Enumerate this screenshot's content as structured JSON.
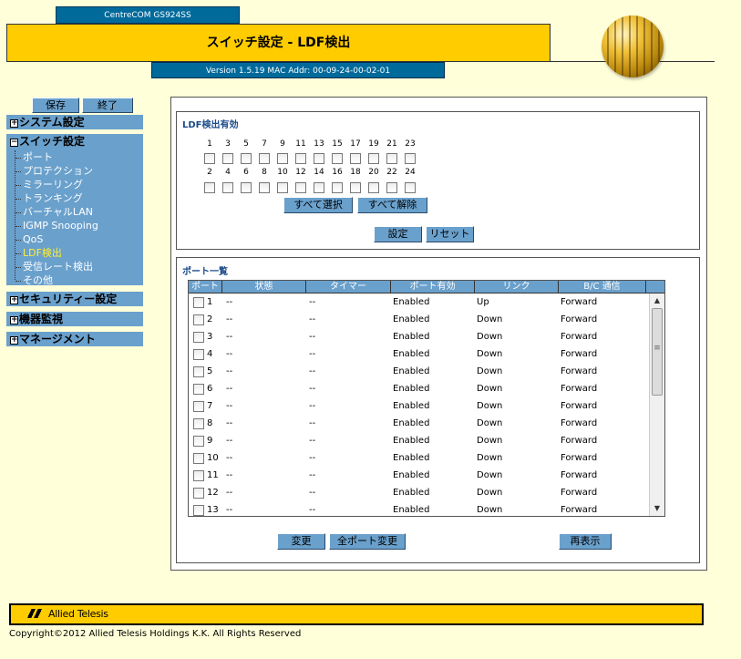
{
  "header": {
    "model": "CentreCOM GS924SS",
    "title": "スイッチ設定 - LDF検出",
    "version": "Version 1.5.19 MAC Addr: 00-09-24-00-02-01"
  },
  "nav": {
    "save_label": "保存",
    "exit_label": "終了",
    "system": "システム設定",
    "switch": "スイッチ設定",
    "switch_items": [
      "ポート",
      "プロテクション",
      "ミラーリング",
      "トランキング",
      "バーチャルLAN",
      "IGMP Snooping",
      "QoS",
      "LDF検出",
      "受信レート検出",
      "その他"
    ],
    "security": "セキュリティー設定",
    "monitor": "機器監視",
    "management": "マネージメント",
    "expand_glyph": "+",
    "collapse_glyph": "−"
  },
  "ldf": {
    "title": "LDF検出有効",
    "odd_ports": [
      "1",
      "3",
      "5",
      "7",
      "9",
      "11",
      "13",
      "15",
      "17",
      "19",
      "21",
      "23"
    ],
    "even_ports": [
      "2",
      "4",
      "6",
      "8",
      "10",
      "12",
      "14",
      "16",
      "18",
      "20",
      "22",
      "24"
    ],
    "select_all": "すべて選択",
    "clear_all": "すべて解除",
    "apply": "設定",
    "reset": "リセット"
  },
  "port_list": {
    "title": "ポート一覧",
    "columns": [
      "ポート",
      "状態",
      "タイマー",
      "ポート有効",
      "リンク",
      "B/C 通信"
    ],
    "rows": [
      [
        "1",
        "--",
        "--",
        "Enabled",
        "Up",
        "Forward"
      ],
      [
        "2",
        "--",
        "--",
        "Enabled",
        "Down",
        "Forward"
      ],
      [
        "3",
        "--",
        "--",
        "Enabled",
        "Down",
        "Forward"
      ],
      [
        "4",
        "--",
        "--",
        "Enabled",
        "Down",
        "Forward"
      ],
      [
        "5",
        "--",
        "--",
        "Enabled",
        "Down",
        "Forward"
      ],
      [
        "6",
        "--",
        "--",
        "Enabled",
        "Down",
        "Forward"
      ],
      [
        "7",
        "--",
        "--",
        "Enabled",
        "Down",
        "Forward"
      ],
      [
        "8",
        "--",
        "--",
        "Enabled",
        "Down",
        "Forward"
      ],
      [
        "9",
        "--",
        "--",
        "Enabled",
        "Down",
        "Forward"
      ],
      [
        "10",
        "--",
        "--",
        "Enabled",
        "Down",
        "Forward"
      ],
      [
        "11",
        "--",
        "--",
        "Enabled",
        "Down",
        "Forward"
      ],
      [
        "12",
        "--",
        "--",
        "Enabled",
        "Down",
        "Forward"
      ],
      [
        "13",
        "--",
        "--",
        "Enabled",
        "Down",
        "Forward"
      ]
    ],
    "change": "変更",
    "change_all": "全ポート変更",
    "refresh": "再表示",
    "scroll_up_glyph": "▲",
    "scroll_down_glyph": "▼"
  },
  "footer": {
    "logo": "Allied Telesis",
    "copyright": "Copyright©2012 Allied Telesis Holdings K.K. All Rights Reserved"
  }
}
